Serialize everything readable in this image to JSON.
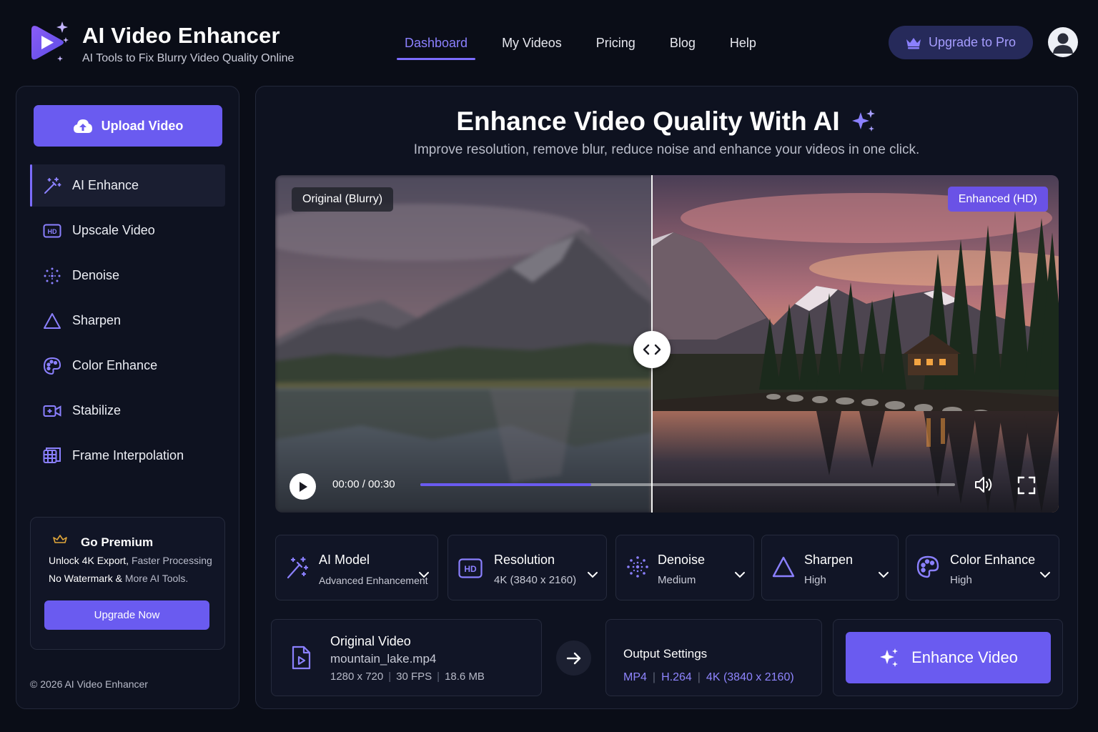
{
  "app": {
    "title": "AI Video Enhancer",
    "subtitle": "AI Tools to Fix Blurry Video Quality Online",
    "logo_icon": "play-sparkle-icon"
  },
  "nav": {
    "items": [
      {
        "label": "Dashboard",
        "active": true
      },
      {
        "label": "My Videos",
        "active": false
      },
      {
        "label": "Pricing",
        "active": false
      },
      {
        "label": "Blog",
        "active": false
      },
      {
        "label": "Help",
        "active": false
      }
    ],
    "upgrade_label": "Upgrade to Pro",
    "upgrade_icon": "crown-icon",
    "avatar_icon": "user-icon"
  },
  "sidebar": {
    "upload_label": "Upload Video",
    "upload_icon": "cloud-upload-icon",
    "items": [
      {
        "label": "AI Enhance",
        "icon": "magic-wand-icon",
        "active": true
      },
      {
        "label": "Upscale Video",
        "icon": "hd-icon",
        "active": false
      },
      {
        "label": "Denoise",
        "icon": "dots-grid-icon",
        "active": false
      },
      {
        "label": "Sharpen",
        "icon": "triangle-icon",
        "active": false
      },
      {
        "label": "Color Enhance",
        "icon": "palette-icon",
        "active": false
      },
      {
        "label": "Stabilize",
        "icon": "video-camera-icon",
        "active": false
      },
      {
        "label": "Frame Interpolation",
        "icon": "frames-icon",
        "active": false
      }
    ],
    "premium": {
      "title": "Go Premium",
      "line1_a": "Unlock 4K Export,",
      "line1_b": " Faster Processing",
      "line2_a": "No Watermark &",
      "line2_b": " More AI Tools.",
      "button": "Upgrade Now"
    },
    "copyright": "© 2026 AI Video Enhancer"
  },
  "hero": {
    "title": "Enhance Video Quality With AI",
    "subtitle": "Improve resolution, remove blur, reduce noise and enhance your videos in one click."
  },
  "player": {
    "left_label": "Original (Blurry)",
    "right_label": "Enhanced (HD)",
    "time": "00:00 / 00:30",
    "progress": 0.32,
    "split": 0.48
  },
  "settings": [
    {
      "label": "AI Model",
      "value": "Advanced Enhancement",
      "icon": "magic-wand-icon"
    },
    {
      "label": "Resolution",
      "value": "4K (3840 x 2160)",
      "icon": "hd-icon"
    },
    {
      "label": "Denoise",
      "value": "Medium",
      "icon": "dots-grid-icon"
    },
    {
      "label": "Sharpen",
      "value": "High",
      "icon": "triangle-icon"
    },
    {
      "label": "Color Enhance",
      "value": "High",
      "icon": "palette-icon"
    }
  ],
  "original_video": {
    "title": "Original Video",
    "filename": "mountain_lake.mp4",
    "resolution": "1280 x 720",
    "fps": "30 FPS",
    "size": "18.6 MB"
  },
  "output": {
    "title": "Output Settings",
    "format": "MP4",
    "codec": "H.264",
    "resolution": "4K (3840 x 2160)"
  },
  "enhance_label": "Enhance Video",
  "colors": {
    "accent": "#6a5bf0",
    "accent_light": "#8b80ff",
    "background": "#0a0d17",
    "panel": "#0e1220"
  }
}
